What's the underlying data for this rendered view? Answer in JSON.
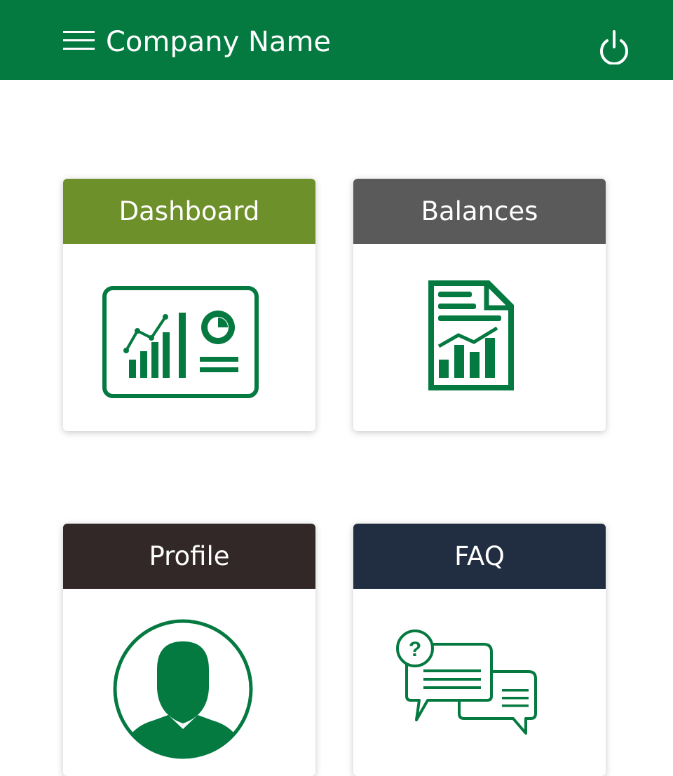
{
  "header": {
    "title": "Company Name",
    "background": "#047940",
    "menu_icon": "hamburger-menu-icon",
    "power_icon": "power-icon"
  },
  "tiles": [
    {
      "label": "Dashboard",
      "color": "#6e902b",
      "icon": "dashboard-chart-icon"
    },
    {
      "label": "Balances",
      "color": "#5a5a5a",
      "icon": "report-document-icon"
    },
    {
      "label": "Profile",
      "color": "#332828",
      "icon": "user-avatar-icon"
    },
    {
      "label": "FAQ",
      "color": "#212e42",
      "icon": "faq-chat-bubbles-icon"
    }
  ],
  "icon_color": "#047940"
}
